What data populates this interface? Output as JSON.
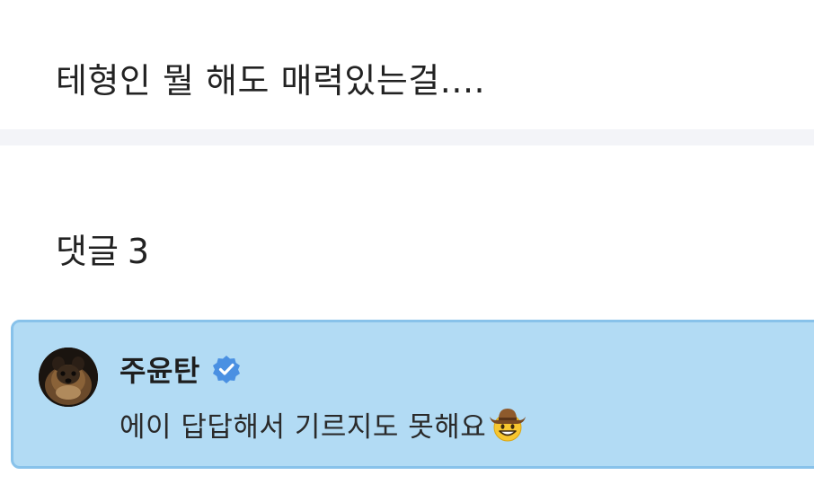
{
  "post": {
    "text": "테형인 뭘 해도 매력있는걸...."
  },
  "comments": {
    "label": "댓글",
    "count": "3",
    "items": [
      {
        "author": "주윤탄",
        "verified": true,
        "verified_icon": "verified-badge-icon",
        "text": "에이 답답해서 기르지도 못해요",
        "emoji_icon": "cowboy-hat-face-icon",
        "highlight_color": "#b2dbf4",
        "border_color": "#88c2ea"
      }
    ]
  },
  "colors": {
    "divider": "#f3f4f8",
    "verified_badge": "#4a90e2"
  }
}
